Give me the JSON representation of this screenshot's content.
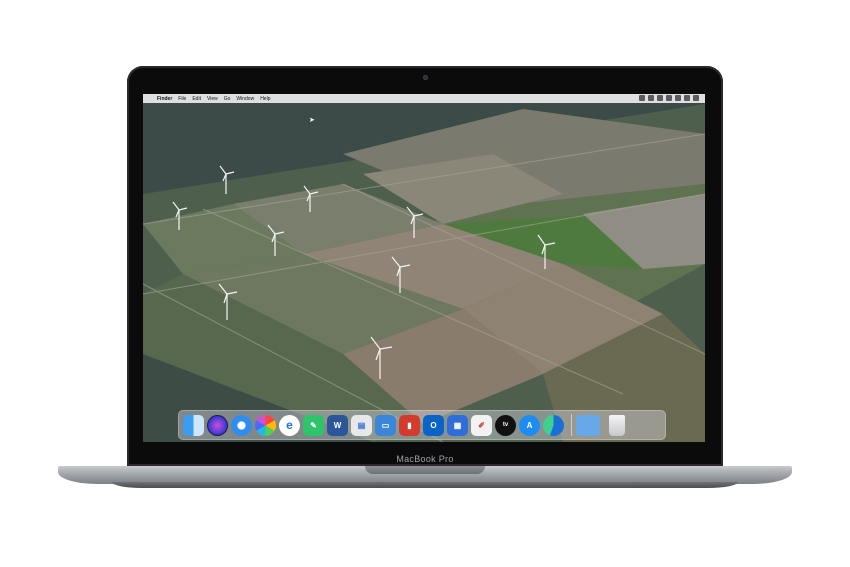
{
  "device": {
    "brand_label": "MacBook Pro"
  },
  "menu_bar": {
    "apple_icon": "apple-logo",
    "items": [
      "Finder",
      "File",
      "Edit",
      "View",
      "Go",
      "Window",
      "Help"
    ]
  },
  "desktop": {
    "wallpaper": "aerial view of farm fields with wind turbines"
  },
  "dock": {
    "apps": [
      {
        "name": "finder-icon",
        "glyph": ""
      },
      {
        "name": "siri-icon",
        "glyph": ""
      },
      {
        "name": "safari-icon",
        "glyph": ""
      },
      {
        "name": "photos-icon",
        "glyph": ""
      },
      {
        "name": "internet-explorer-icon",
        "glyph": "e"
      },
      {
        "name": "notes-icon",
        "glyph": "✎"
      },
      {
        "name": "word-icon",
        "glyph": "W"
      },
      {
        "name": "keynote-icon",
        "glyph": "▤"
      },
      {
        "name": "monitor-icon",
        "glyph": "▭"
      },
      {
        "name": "red-app-icon",
        "glyph": "▮"
      },
      {
        "name": "outlook-icon",
        "glyph": "O"
      },
      {
        "name": "keynote-blue-icon",
        "glyph": "▦"
      },
      {
        "name": "paint-icon",
        "glyph": "✐"
      },
      {
        "name": "apple-tv-icon",
        "glyph": "tv"
      },
      {
        "name": "app-store-icon",
        "glyph": "A"
      },
      {
        "name": "edge-icon",
        "glyph": ""
      }
    ],
    "folder_icon": "folder-icon",
    "trash_icon": "trash-icon"
  }
}
